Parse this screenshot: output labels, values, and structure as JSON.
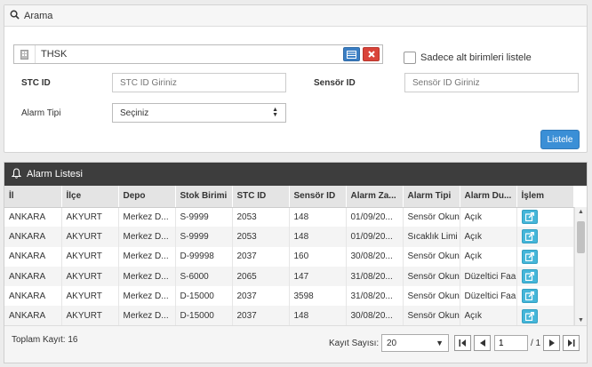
{
  "search": {
    "title": "Arama",
    "unit_value": "THSK",
    "only_sub_units_label": "Sadece alt birimleri listele",
    "stc_id_label": "STC ID",
    "stc_id_placeholder": "STC ID Giriniz",
    "sensor_id_label": "Sensör ID",
    "sensor_id_placeholder": "Sensör ID Giriniz",
    "alarm_type_label": "Alarm Tipi",
    "alarm_type_value": "Seçiniz",
    "list_button": "Listele"
  },
  "alarm_list": {
    "title": "Alarm Listesi",
    "columns": [
      "İl",
      "İlçe",
      "Depo",
      "Stok Birimi",
      "STC ID",
      "Sensör ID",
      "Alarm Za...",
      "Alarm Tipi",
      "Alarm Du...",
      "İşlem"
    ],
    "rows": [
      [
        "ANKARA",
        "AKYURT",
        "Merkez D...",
        "S-9999",
        "2053",
        "148",
        "01/09/20...",
        "Sensör Okun",
        "Açık"
      ],
      [
        "ANKARA",
        "AKYURT",
        "Merkez D...",
        "S-9999",
        "2053",
        "148",
        "01/09/20...",
        "Sıcaklık Limi",
        "Açık"
      ],
      [
        "ANKARA",
        "AKYURT",
        "Merkez D...",
        "D-99998",
        "2037",
        "160",
        "30/08/20...",
        "Sensör Okun",
        "Açık"
      ],
      [
        "ANKARA",
        "AKYURT",
        "Merkez D...",
        "S-6000",
        "2065",
        "147",
        "31/08/20...",
        "Sensör Okun",
        "Düzeltici Faa"
      ],
      [
        "ANKARA",
        "AKYURT",
        "Merkez D...",
        "D-15000",
        "2037",
        "3598",
        "31/08/20...",
        "Sensör Okun",
        "Düzeltici Faa"
      ],
      [
        "ANKARA",
        "AKYURT",
        "Merkez D...",
        "D-15000",
        "2037",
        "148",
        "30/08/20...",
        "Sensör Okun",
        "Açık"
      ]
    ],
    "total_label": "Toplam Kayıt: 16",
    "page_size_label": "Kayıt Sayısı:",
    "page_size_value": "20",
    "current_page": "1",
    "page_of": "/ 1"
  },
  "colors": {
    "primary_button": "#3b8fd6",
    "danger_button": "#d9443a",
    "action_button": "#45b6d9",
    "panel_header_dark": "#3d3d3d"
  }
}
